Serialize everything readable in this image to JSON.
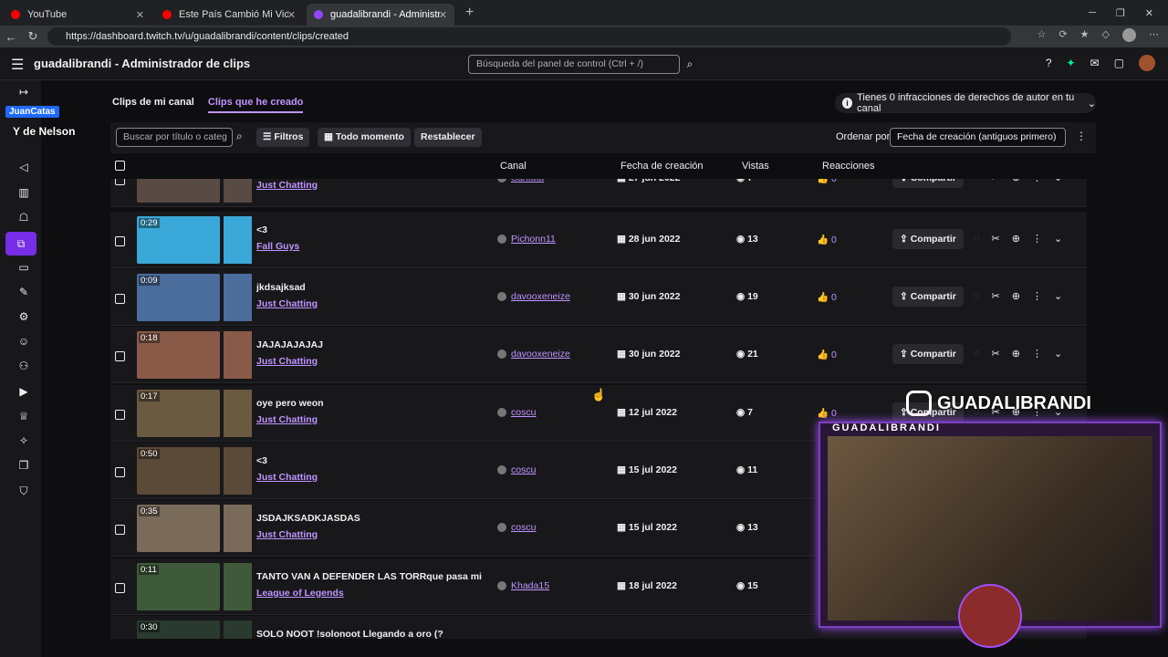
{
  "browser": {
    "tabs": [
      {
        "title": "YouTube",
        "color": "#ff0000"
      },
      {
        "title": "Este País Cambió Mi Vida - YouTu",
        "color": "#ff0000"
      },
      {
        "title": "guadalibrandi - Administrador de",
        "color": "#9146ff"
      }
    ],
    "url": "https://dashboard.twitch.tv/u/guadalibrandi/content/clips/created"
  },
  "header": {
    "title": "guadalibrandi - Administrador de clips",
    "search_placeholder": "Búsqueda del panel de control (Ctrl + /)"
  },
  "overlay": {
    "name": "JuanCatas",
    "sub": "Y de Nelson"
  },
  "tabs": {
    "mine": "Clips de mi canal",
    "created": "Clips que he creado"
  },
  "infringements": "Tienes 0 infracciones de derechos de autor en tu canal",
  "toolbar": {
    "search_placeholder": "Buscar por título o categ",
    "filters": "Filtros",
    "anytime": "Todo momento",
    "reset": "Restablecer",
    "sort_label": "Ordenar por",
    "sort_value": "Fecha de creación (antiguos primero)"
  },
  "columns": {
    "channel": "Canal",
    "created": "Fecha de creación",
    "views": "Vistas",
    "reactions": "Reacciones"
  },
  "share_label": "Compartir",
  "clips": [
    {
      "duration": "",
      "title": "",
      "category": "Just Chatting",
      "channel": "Santutu",
      "date": "27 jun 2022",
      "views": "7",
      "reactions": "0"
    },
    {
      "duration": "0:29",
      "title": "<3",
      "category": "Fall Guys",
      "channel": "Pichonn11",
      "date": "28 jun 2022",
      "views": "13",
      "reactions": "0"
    },
    {
      "duration": "0:09",
      "title": "jkdsajksad",
      "category": "Just Chatting",
      "channel": "davooxeneize",
      "date": "30 jun 2022",
      "views": "19",
      "reactions": "0"
    },
    {
      "duration": "0:18",
      "title": "JAJAJAJAJAJ",
      "category": "Just Chatting",
      "channel": "davooxeneize",
      "date": "30 jun 2022",
      "views": "21",
      "reactions": "0"
    },
    {
      "duration": "0:17",
      "title": "oye pero weon",
      "category": "Just Chatting",
      "channel": "coscu",
      "date": "12 jul 2022",
      "views": "7",
      "reactions": "0"
    },
    {
      "duration": "0:50",
      "title": "<3",
      "category": "Just Chatting",
      "channel": "coscu",
      "date": "15 jul 2022",
      "views": "11",
      "reactions": ""
    },
    {
      "duration": "0:35",
      "title": "JSDAJKSADKJASDAS",
      "category": "Just Chatting",
      "channel": "coscu",
      "date": "15 jul 2022",
      "views": "13",
      "reactions": ""
    },
    {
      "duration": "0:11",
      "title": "TANTO VAN A DEFENDER LAS TORRque pasa mi amo...",
      "category": "League of Legends",
      "channel": "Khada15",
      "date": "18 jul 2022",
      "views": "15",
      "reactions": ""
    },
    {
      "duration": "0:30",
      "title": "SOLO NOOT !solonoot Llegando a oro (?",
      "category": "",
      "channel": "",
      "date": "",
      "views": "",
      "reactions": ""
    }
  ],
  "stream_overlay": {
    "camera_label": "GUADALIBRANDI",
    "instagram_handle": "GUADALIBRANDI"
  },
  "colors": {
    "accent": "#bf94ff",
    "brand": "#9146ff",
    "bg": "#0e0e10"
  }
}
